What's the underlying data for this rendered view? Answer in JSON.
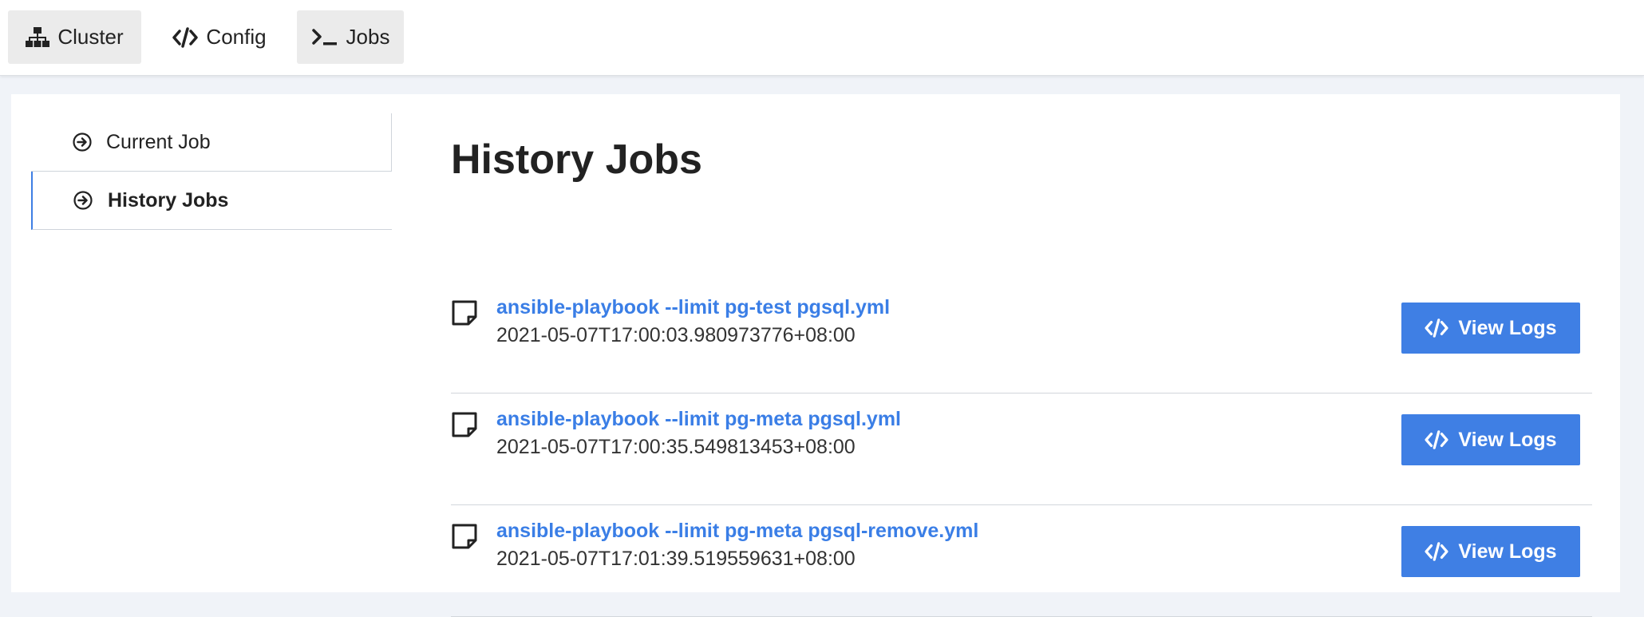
{
  "topnav": {
    "items": [
      {
        "label": "Cluster",
        "icon": "sitemap-icon"
      },
      {
        "label": "Config",
        "icon": "code-icon"
      },
      {
        "label": "Jobs",
        "icon": "terminal-icon"
      }
    ]
  },
  "sidebar": {
    "items": [
      {
        "label": "Current Job",
        "icon": "arrow-circle-right-icon"
      },
      {
        "label": "History Jobs",
        "icon": "arrow-circle-right-icon",
        "active": true
      }
    ]
  },
  "main": {
    "title": "History Jobs",
    "jobs": [
      {
        "command": "ansible-playbook --limit pg-test pgsql.yml",
        "timestamp": "2021-05-07T17:00:03.980973776+08:00",
        "button_label": "View Logs"
      },
      {
        "command": "ansible-playbook --limit pg-meta pgsql.yml",
        "timestamp": "2021-05-07T17:00:35.549813453+08:00",
        "button_label": "View Logs"
      },
      {
        "command": "ansible-playbook --limit pg-meta pgsql-remove.yml",
        "timestamp": "2021-05-07T17:01:39.519559631+08:00",
        "button_label": "View Logs"
      }
    ]
  },
  "colors": {
    "accent": "#3f7fe4",
    "link": "#3a7ee6",
    "nav_active_bg": "#ebebeb",
    "page_bg": "#f0f3f8"
  }
}
